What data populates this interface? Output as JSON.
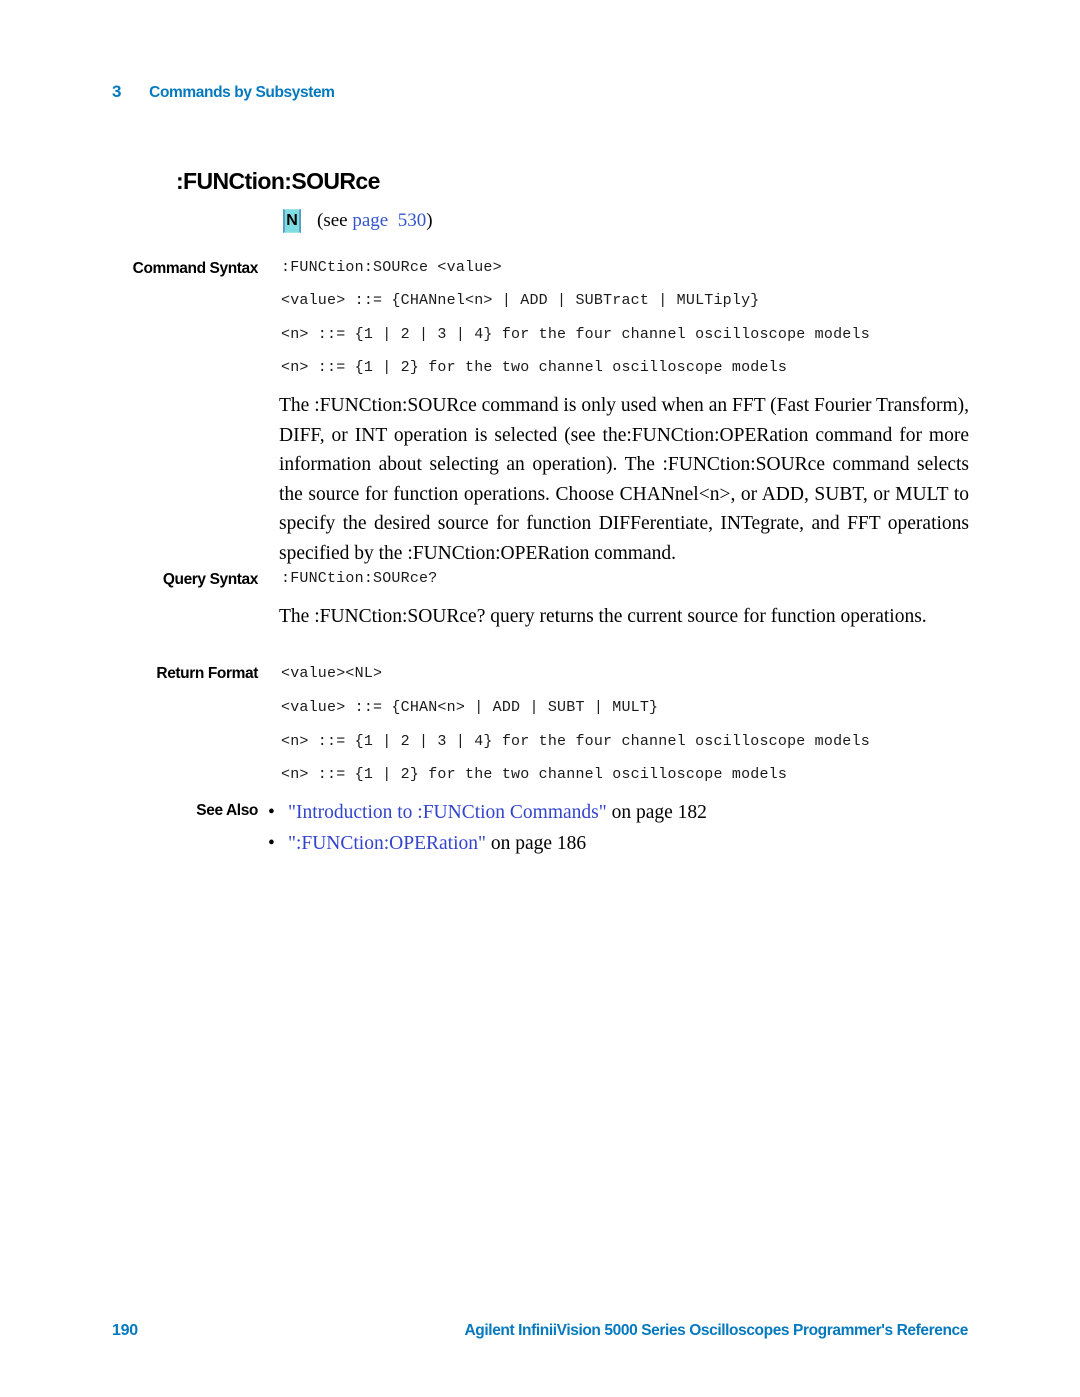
{
  "header": {
    "chapter_number": "3",
    "chapter_title": "Commands by Subsystem"
  },
  "command": {
    "title": ":FUNCtion:SOURce",
    "note_badge": "N",
    "note_prefix": "(see ",
    "note_link": "page  530",
    "note_suffix": ")"
  },
  "sections": {
    "command_syntax_label": "Command Syntax",
    "query_syntax_label": "Query Syntax",
    "return_format_label": "Return Format",
    "see_also_label": "See Also"
  },
  "command_syntax": {
    "lines": [
      ":FUNCtion:SOURce <value>",
      "<value> ::= {CHANnel<n> | ADD | SUBTract | MULTiply}",
      "<n> ::= {1 | 2 | 3 | 4} for the four channel oscilloscope models",
      "<n> ::= {1 | 2} for the two channel oscilloscope models"
    ],
    "description": "The :FUNCtion:SOURce command is only used when an FFT (Fast Fourier Transform), DIFF, or INT operation is selected (see the:FUNCtion:OPERation command for more information about selecting an operation). The :FUNCtion:SOURce command selects the source for function operations. Choose CHANnel<n>, or ADD, SUBT, or MULT to specify the desired source for function DIFFerentiate, INTegrate, and FFT operations specified by the :FUNCtion:OPERation command."
  },
  "query_syntax": {
    "line": ":FUNCtion:SOURce?",
    "description": "The :FUNCtion:SOURce? query returns the current source for function operations."
  },
  "return_format": {
    "lines": [
      "<value><NL>",
      "<value> ::= {CHAN<n> | ADD | SUBT | MULT}",
      "<n> ::= {1 | 2 | 3 | 4} for the four channel oscilloscope models",
      "<n> ::= {1 | 2} for the two channel oscilloscope models"
    ]
  },
  "see_also": {
    "items": [
      {
        "bullet": "•",
        "link": "\"Introduction to :FUNCtion Commands\"",
        "tail": " on  page  182"
      },
      {
        "bullet": "•",
        "link": "\":FUNCtion:OPERation\"",
        "tail": " on  page  186"
      }
    ]
  },
  "footer": {
    "page_number": "190",
    "title": "Agilent InfiniiVision 5000 Series Oscilloscopes Programmer's Reference"
  },
  "colors": {
    "brand_blue": "#0579be",
    "link_blue": "#3344cc",
    "badge_cyan": "#7fdde2"
  }
}
